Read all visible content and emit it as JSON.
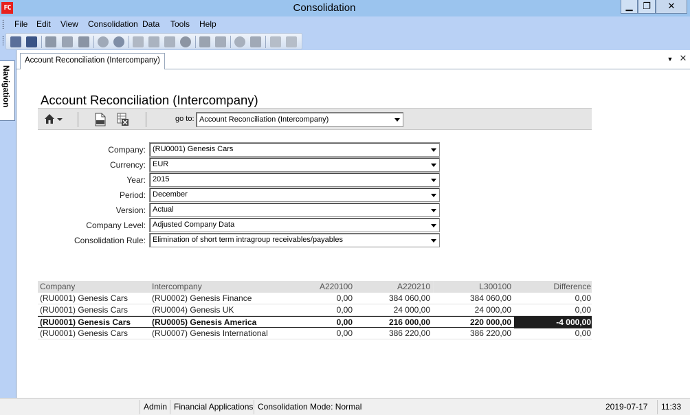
{
  "window": {
    "app_icon_text": "FC",
    "title": "Consolidation",
    "minimize_symbol": "▁",
    "maximize_symbol": "❐",
    "close_symbol": "✕"
  },
  "menu": [
    "File",
    "Edit",
    "View",
    "Consolidation",
    "Data",
    "Tools",
    "Help"
  ],
  "toolbar": {
    "icons": [
      "save-icon",
      "save-all-icon",
      "print-icon",
      "print-preview-icon",
      "print-setup-icon",
      "globe-icon",
      "refresh-globe-icon",
      "cut-icon",
      "copy-icon",
      "paste-icon",
      "cancel-icon",
      "insert-table-icon",
      "table-grid-icon",
      "refresh-icon",
      "save-layout-icon",
      "arrow-up-icon",
      "arrow-down-icon"
    ]
  },
  "navigation_tab": "Navigation",
  "document_tab": "Account Reconciliation (Intercompany)",
  "tab_dropdown_symbol": "▼",
  "tab_close_symbol": "✕",
  "page_title": "Account Reconciliation (Intercompany)",
  "report_toolbar": {
    "home_symbol": "⌂",
    "goto_label": "go to:",
    "goto_value": "Account Reconciliation (Intercompany)"
  },
  "filters": [
    {
      "label": "Company:",
      "value": "(RU0001) Genesis Cars"
    },
    {
      "label": "Currency:",
      "value": "EUR"
    },
    {
      "label": "Year:",
      "value": "2015"
    },
    {
      "label": "Period:",
      "value": "December"
    },
    {
      "label": "Version:",
      "value": "Actual"
    },
    {
      "label": "Company Level:",
      "value": "Adjusted Company Data"
    },
    {
      "label": "Consolidation Rule:",
      "value": "Elimination of short term intragroup receivables/payables"
    }
  ],
  "table": {
    "headers": [
      "Company",
      "Intercompany",
      "A220100",
      "A220210",
      "L300100",
      "Difference"
    ],
    "rows": [
      [
        "(RU0001) Genesis Cars",
        "(RU0002) Genesis Finance",
        "0,00",
        "384 060,00",
        "384 060,00",
        "0,00"
      ],
      [
        "(RU0001) Genesis Cars",
        "(RU0004) Genesis UK",
        "0,00",
        "24 000,00",
        "24 000,00",
        "0,00"
      ],
      [
        "(RU0001) Genesis Cars",
        "(RU0005) Genesis America",
        "0,00",
        "216 000,00",
        "220 000,00",
        "-4 000,00"
      ],
      [
        "(RU0001) Genesis Cars",
        "(RU0007) Genesis International",
        "0,00",
        "386 220,00",
        "386 220,00",
        "0,00"
      ]
    ]
  },
  "status": {
    "user": "Admin",
    "app": "Financial Applications",
    "mode": "Consolidation Mode: Normal",
    "date": "2019-07-17",
    "time": "11:33"
  },
  "colors": {
    "titlebar": "#9bc4ee",
    "menubar": "#b9d1f5",
    "highlight_cell": "#1e1e1e"
  }
}
